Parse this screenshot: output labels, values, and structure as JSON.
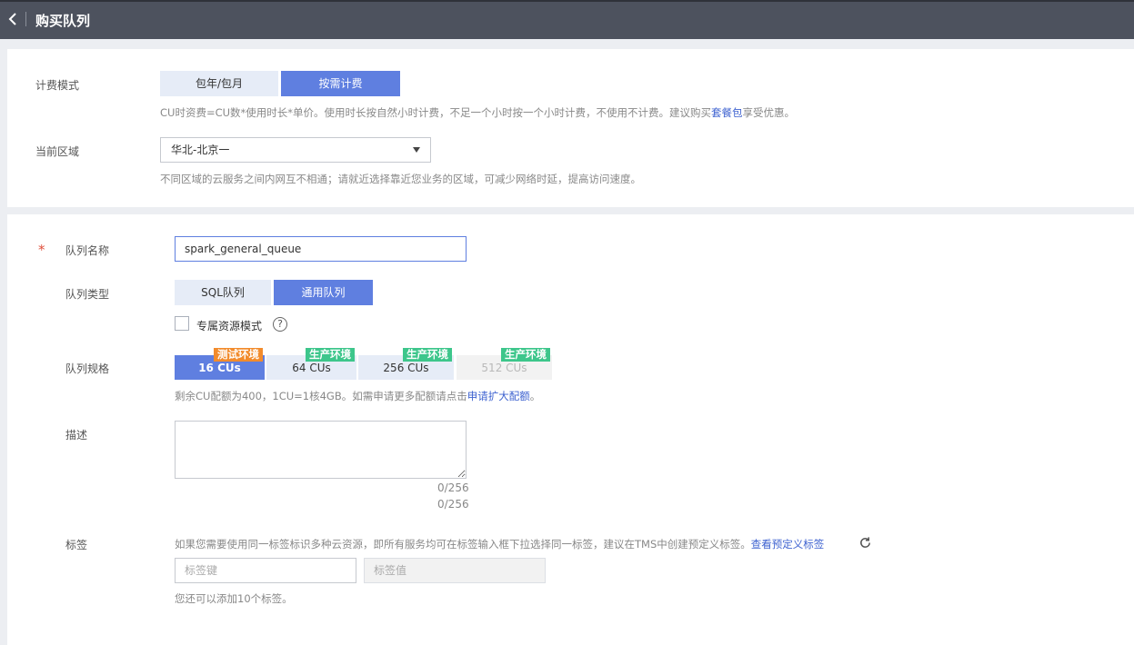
{
  "header": {
    "title": "购买队列",
    "back_icon": "chevron-left-icon"
  },
  "billing": {
    "label": "计费模式",
    "options": [
      "包年/包月",
      "按需计费"
    ],
    "selected": "按需计费",
    "hint_prefix": "CU时资费=CU数*使用时长*单价。使用时长按自然小时计费，不足一个小时按一个小时计费，不使用不计费。建议购买",
    "hint_link": "套餐包",
    "hint_suffix": "享受优惠。"
  },
  "region": {
    "label": "当前区域",
    "value": "华北-北京一",
    "hint": "不同区域的云服务之间内网互不相通；请就近选择靠近您业务的区域，可减少网络时延，提高访问速度。"
  },
  "queue_name": {
    "required_mark": "*",
    "label": "队列名称",
    "value": "spark_general_queue"
  },
  "queue_type": {
    "label": "队列类型",
    "options": [
      "SQL队列",
      "通用队列"
    ],
    "selected": "通用队列",
    "dedicated_label": "专属资源模式",
    "dedicated_checked": false,
    "help_icon": "question-circle-icon",
    "help_glyph": "?"
  },
  "queue_spec": {
    "label": "队列规格",
    "options": [
      {
        "label": "16 CUs",
        "tag": "测试环境",
        "state": "selected"
      },
      {
        "label": "64 CUs",
        "tag": "生产环境",
        "state": "normal"
      },
      {
        "label": "256 CUs",
        "tag": "生产环境",
        "state": "normal"
      },
      {
        "label": "512 CUs",
        "tag": "生产环境",
        "state": "disabled"
      }
    ],
    "hint_prefix": "剩余CU配额为400，1CU=1核4GB。如需申请更多配额请点击",
    "hint_link": "申请扩大配额",
    "hint_suffix": "。"
  },
  "description": {
    "label": "描述",
    "value": "",
    "counter_inside": "0/256",
    "counter_outside": "0/256"
  },
  "tags": {
    "label": "标签",
    "hint_prefix": "如果您需要使用同一标签标识多种云资源，即所有服务均可在标签输入框下拉选择同一标签，建议在TMS中创建预定义标签。",
    "hint_link": "查看预定义标签",
    "refresh_icon": "refresh-icon",
    "key_placeholder": "标签键",
    "value_placeholder": "标签值",
    "remaining_hint": "您还可以添加10个标签。"
  },
  "colors": {
    "header_bg": "#4d525e",
    "accent": "#5f7fe0",
    "segment_off": "#e6ecf7",
    "tag_test": "#f28b2c",
    "tag_prod": "#3dc68b",
    "link": "#3f63d0",
    "required": "#e0503c"
  }
}
